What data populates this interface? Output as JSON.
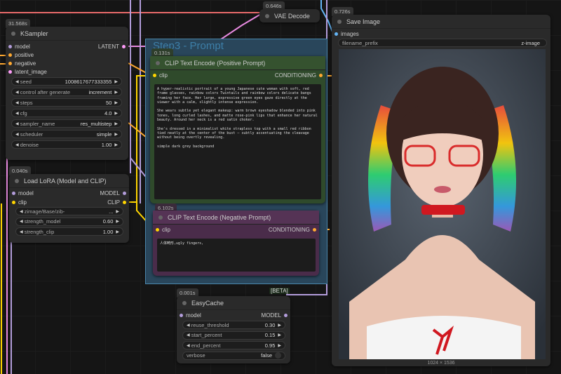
{
  "ksampler": {
    "time": "31.568s",
    "title": "KSampler",
    "inputs": [
      "model",
      "positive",
      "negative",
      "latent_image"
    ],
    "output": "LATENT",
    "widgets": [
      {
        "label": "seed",
        "value": "1008617677333355"
      },
      {
        "label": "control after generate",
        "value": "increment"
      },
      {
        "label": "steps",
        "value": "50"
      },
      {
        "label": "cfg",
        "value": "4.0"
      },
      {
        "label": "sampler_name",
        "value": "res_multistep"
      },
      {
        "label": "scheduler",
        "value": "simple"
      },
      {
        "label": "denoise",
        "value": "1.00"
      }
    ]
  },
  "lora": {
    "time": "0.040s",
    "title": "Load LoRA (Model and CLIP)",
    "inputs": [
      "model",
      "clip"
    ],
    "outputs": [
      "MODEL",
      "CLIP"
    ],
    "widgets": [
      {
        "label": "zimage/Base/zib-",
        "value": "..."
      },
      {
        "label": "strength_model",
        "value": "0.60"
      },
      {
        "label": "strength_clip",
        "value": "1.00"
      }
    ]
  },
  "vae": {
    "time": "0.646s",
    "title": "VAE Decode"
  },
  "group": {
    "title": "Step3 - Prompt"
  },
  "positive": {
    "time": "0.131s",
    "title": "CLIP Text Encode (Positive Prompt)",
    "input": "clip",
    "output": "CONDITIONING",
    "text": "A hyper-realistic portrait of a young Japanese cute woman with soft, red frame glasses, rainbow colors Twintails and rainbow colors delicate bangs framing her face. Her large, expressive green eyes gaze directly at the viewer with a calm, slightly intense expression.\n\nShe wears subtle yet elegant makeup: warm brown eyeshadow blended into pink tones, long curled lashes, and matte rose-pink lips that enhance her natural beauty. Around her neck is a red satin choker.\n\nShe's dressed in a minimalist white strapless top with a small red ribbon tied neatly at the center of the bust — subtly accentuating the cleavage without being overtly revealing.\n\nsimple dark grey background"
  },
  "negative": {
    "time": "6.102s",
    "title": "CLIP Text Encode (Negative Prompt)",
    "input": "clip",
    "output": "CONDITIONING",
    "text": "人体畸形,ugly fingers,"
  },
  "beta": "[BETA]",
  "easycache": {
    "time": "0.001s",
    "title": "EasyCache",
    "input": "model",
    "output": "MODEL",
    "widgets": [
      {
        "label": "reuse_threshold",
        "value": "0.30"
      },
      {
        "label": "start_percent",
        "value": "0.15"
      },
      {
        "label": "end_percent",
        "value": "0.95"
      },
      {
        "label": "verbose",
        "value": "false"
      }
    ]
  },
  "save": {
    "time": "0.726s",
    "title": "Save Image",
    "input": "images",
    "prefix_label": "filename_prefix",
    "prefix_value": "z-image",
    "dimensions": "1024 × 1536"
  },
  "colors": {
    "model": "#b39ddb",
    "clip": "#ffd500",
    "cond": "#ffa931",
    "latent": "#ff9cf9",
    "image": "#64b5f6",
    "vae": "#ff6e6e"
  }
}
